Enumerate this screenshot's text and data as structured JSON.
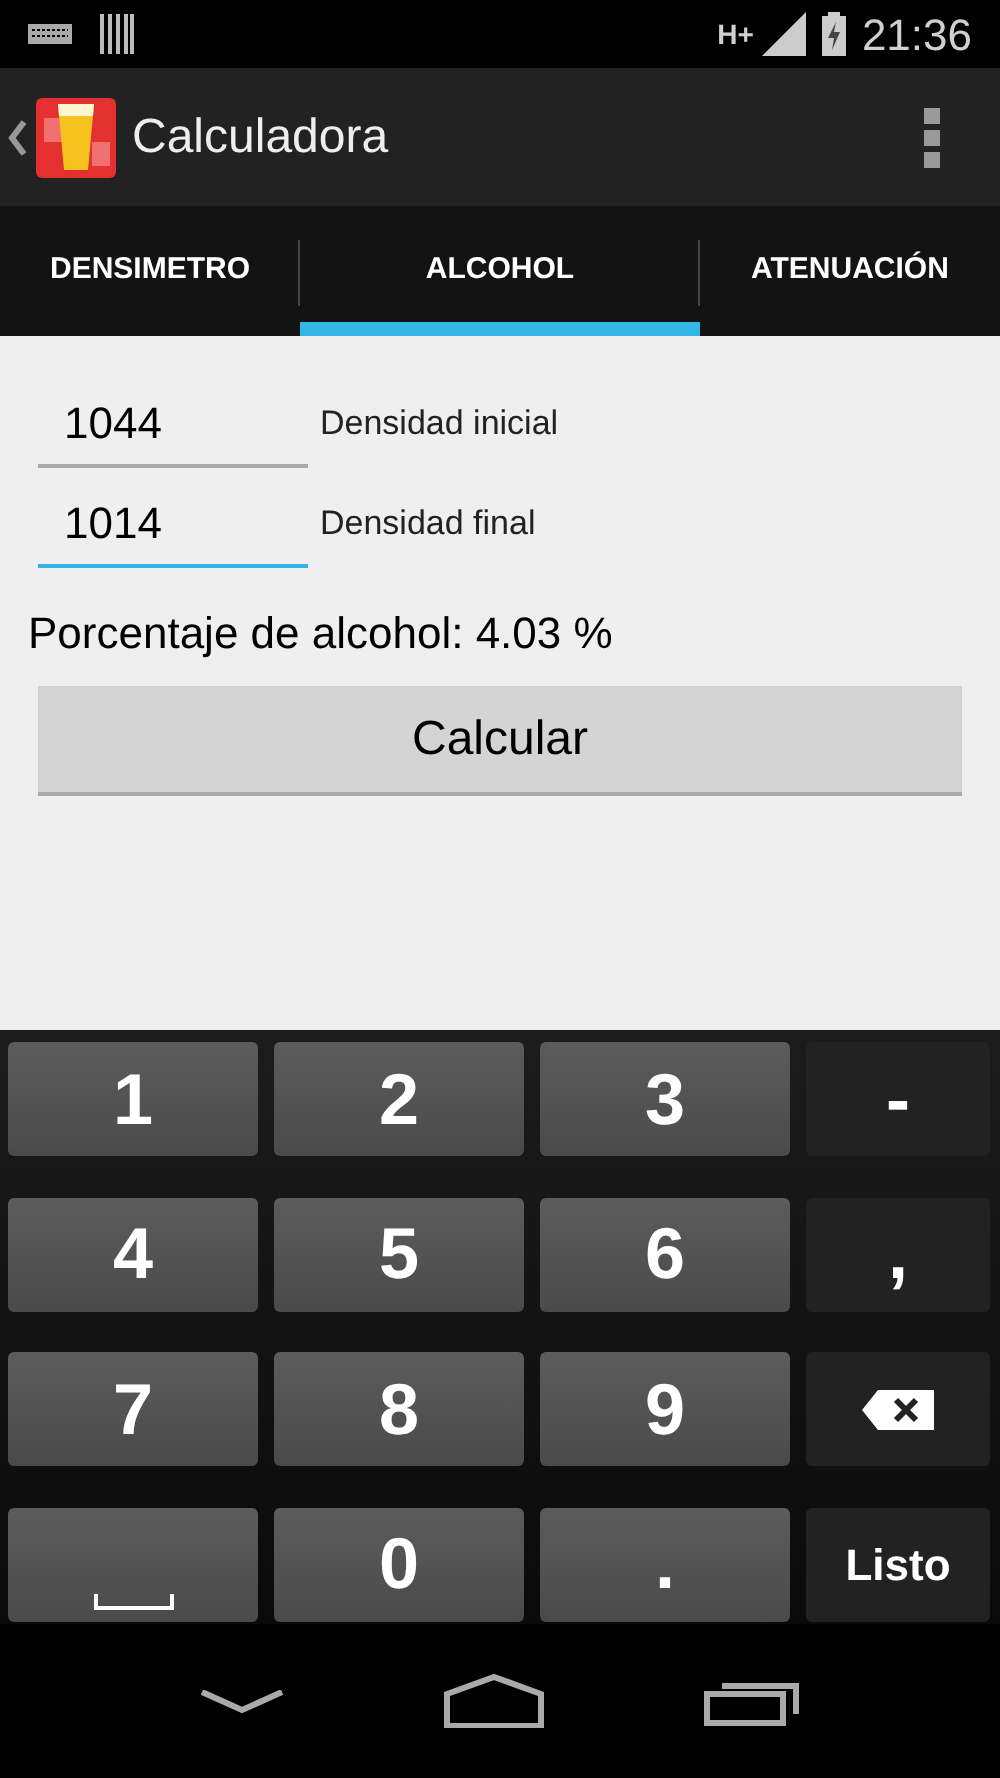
{
  "status_bar": {
    "network": "H+",
    "time": "21:36"
  },
  "action_bar": {
    "title": "Calculadora"
  },
  "tabs": [
    {
      "label": "DENSIMETRO",
      "selected": false
    },
    {
      "label": "ALCOHOL",
      "selected": true
    },
    {
      "label": "ATENUACIÓN",
      "selected": false
    }
  ],
  "fields": [
    {
      "value": "1044",
      "label": "Densidad inicial",
      "focused": false
    },
    {
      "value": "1014",
      "label": "Densidad final",
      "focused": true
    }
  ],
  "result": "Porcentaje de alcohol: 4.03 %",
  "calculate_button": "Calcular",
  "keyboard": [
    [
      {
        "kind": "digit",
        "label": "1"
      },
      {
        "kind": "digit",
        "label": "2"
      },
      {
        "kind": "digit",
        "label": "3"
      },
      {
        "kind": "symbol",
        "label": "-"
      }
    ],
    [
      {
        "kind": "digit",
        "label": "4"
      },
      {
        "kind": "digit",
        "label": "5"
      },
      {
        "kind": "digit",
        "label": "6"
      },
      {
        "kind": "symbol",
        "label": ","
      }
    ],
    [
      {
        "kind": "digit",
        "label": "7"
      },
      {
        "kind": "digit",
        "label": "8"
      },
      {
        "kind": "digit",
        "label": "9"
      },
      {
        "kind": "backspace"
      }
    ],
    [
      {
        "kind": "space"
      },
      {
        "kind": "digit",
        "label": "0"
      },
      {
        "kind": "digit",
        "label": "."
      },
      {
        "kind": "done",
        "label": "Listo"
      }
    ]
  ]
}
